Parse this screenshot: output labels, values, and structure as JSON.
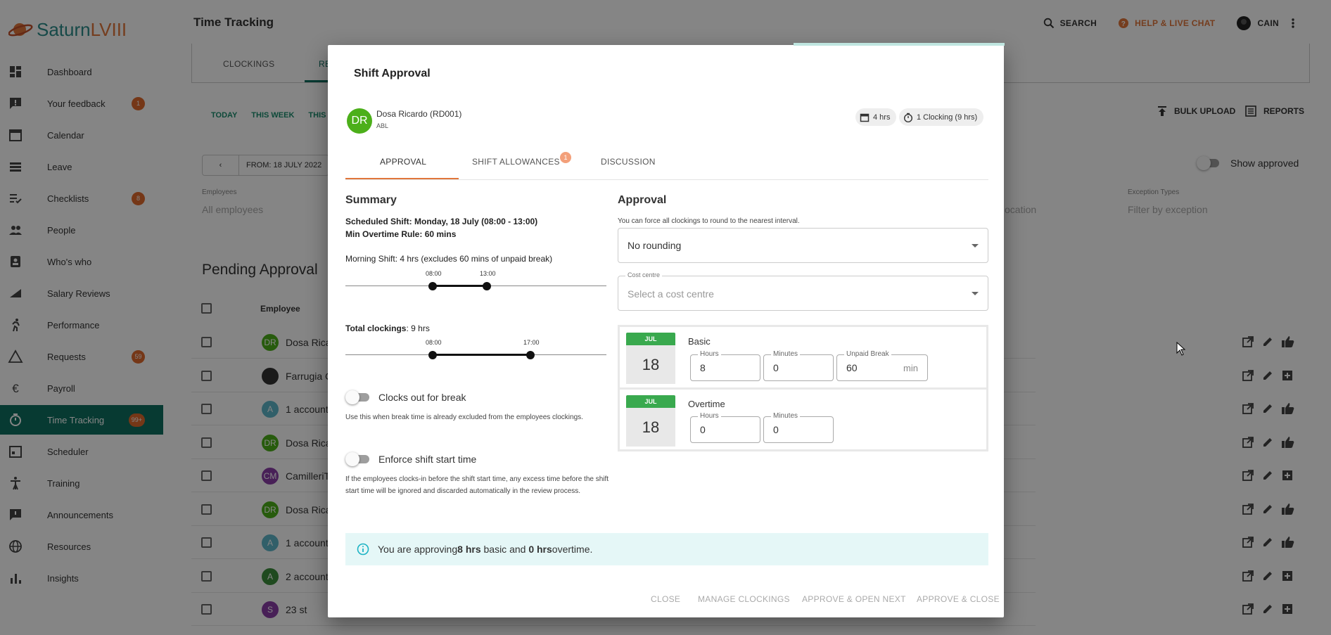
{
  "app": {
    "brand_name": "Saturn",
    "brand_suffix": "LVIII",
    "page_title": "Time Tracking"
  },
  "header": {
    "search": "SEARCH",
    "help": "HELP & LIVE CHAT",
    "user": "CAIN"
  },
  "sidebar": {
    "items": [
      {
        "label": "Dashboard",
        "icon": "dashboard-icon",
        "badge": ""
      },
      {
        "label": "Your feedback",
        "icon": "feedback-icon",
        "badge": "1"
      },
      {
        "label": "Calendar",
        "icon": "calendar-icon",
        "badge": ""
      },
      {
        "label": "Leave",
        "icon": "leave-icon",
        "badge": ""
      },
      {
        "label": "Checklists",
        "icon": "checklist-icon",
        "badge": "8"
      },
      {
        "label": "People",
        "icon": "people-icon",
        "badge": ""
      },
      {
        "label": "Who's who",
        "icon": "badge-icon",
        "badge": ""
      },
      {
        "label": "Salary Reviews",
        "icon": "salary-icon",
        "badge": ""
      },
      {
        "label": "Performance",
        "icon": "run-icon",
        "badge": ""
      },
      {
        "label": "Requests",
        "icon": "warning-icon",
        "badge": "59"
      },
      {
        "label": "Payroll",
        "icon": "euro-icon",
        "badge": ""
      },
      {
        "label": "Time Tracking",
        "icon": "timer-icon",
        "badge": "99+"
      },
      {
        "label": "Scheduler",
        "icon": "scheduler-icon",
        "badge": ""
      },
      {
        "label": "Training",
        "icon": "training-icon",
        "badge": ""
      },
      {
        "label": "Announcements",
        "icon": "announcement-icon",
        "badge": ""
      },
      {
        "label": "Resources",
        "icon": "globe-icon",
        "badge": ""
      },
      {
        "label": "Insights",
        "icon": "insights-icon",
        "badge": ""
      }
    ]
  },
  "page": {
    "tabs": [
      "CLOCKINGS",
      "RE"
    ],
    "filters": [
      "TODAY",
      "THIS WEEK",
      "THIS M"
    ],
    "bulk_upload": "BULK UPLOAD",
    "reports": "REPORTS",
    "date_from": "FROM: 18 JULY 2022",
    "employees_label": "Employees",
    "employees_value": "All employees",
    "location_value": "ocation",
    "exception_label": "Exception Types",
    "exception_value": "Filter by exception",
    "show_approved": "Show approved",
    "pending_title": "Pending Approval",
    "employee_col": "Employee",
    "rows": [
      {
        "initials": "DR",
        "name": "Dosa Rica",
        "color": "#4caf1a"
      },
      {
        "initials": "",
        "name": "Farrugia C",
        "color": "#333333"
      },
      {
        "initials": "A",
        "name": "1 account",
        "color": "#5fb6c9"
      },
      {
        "initials": "DR",
        "name": "Dosa Rica",
        "color": "#4caf1a"
      },
      {
        "initials": "CM",
        "name": "CamilleriT",
        "color": "#8b3fa8"
      },
      {
        "initials": "DR",
        "name": "Dosa Rica",
        "color": "#4caf1a"
      },
      {
        "initials": "A",
        "name": "1 account",
        "color": "#5fb6c9"
      },
      {
        "initials": "A",
        "name": "2 account",
        "color": "#3d8f3d"
      },
      {
        "initials": "S",
        "name": "23 st",
        "color": "#8b3fa8"
      }
    ]
  },
  "modal": {
    "title": "Shift Approval",
    "employee": {
      "initials": "DR",
      "name": "Dosa Ricardo (RD001)",
      "company": "ABL"
    },
    "chips": {
      "scheduled": "4 hrs",
      "clockings": "1 Clocking (9 hrs)"
    },
    "tabs": {
      "approval": "APPROVAL",
      "allowances": "SHIFT ALLOWANCES",
      "allowances_badge": "1",
      "discussion": "DISCUSSION"
    },
    "summary": {
      "heading": "Summary",
      "scheduled": "Scheduled Shift: Monday, 18 July (08:00 - 13:00)",
      "overtime_rule": "Min Overtime Rule: 60 mins",
      "morning": "Morning Shift: 4 hrs (excludes 60 mins of unpaid break)",
      "shift_start": "08:00",
      "shift_end": "13:00",
      "total_label": "Total clockings",
      "total_value": ": 9 hrs",
      "clock_start": "08:00",
      "clock_end": "17:00",
      "break_toggle": "Clocks out for break",
      "break_help": "Use this when break time is already excluded from the employees clockings.",
      "enforce_toggle": "Enforce shift start time",
      "enforce_help": "If the employees clocks-in before the shift start time, any excess time before the shift start time will be ignored and discarded automatically in the review process."
    },
    "approval": {
      "heading": "Approval",
      "round_help": "You can force all clockings to round to the nearest interval.",
      "rounding": "No rounding",
      "cost_label": "Cost centre",
      "cost_placeholder": "Select a cost centre",
      "basic": {
        "month": "JUL",
        "day": "18",
        "title": "Basic",
        "hours_label": "Hours",
        "hours": "8",
        "minutes_label": "Minutes",
        "minutes": "0",
        "break_label": "Unpaid Break",
        "break": "60",
        "break_unit": "min"
      },
      "overtime": {
        "month": "JUL",
        "day": "18",
        "title": "Overtime",
        "hours_label": "Hours",
        "hours": "0",
        "minutes_label": "Minutes",
        "minutes": "0"
      }
    },
    "info": {
      "pre": "You are approving ",
      "basic": "8 hrs",
      "mid": " basic and ",
      "ot": "0 hrs",
      "post": " overtime."
    },
    "footer": {
      "close": "CLOSE",
      "manage": "MANAGE CLOCKINGS",
      "approve_next": "APPROVE & OPEN NEXT",
      "approve_close": "APPROVE & CLOSE"
    }
  }
}
